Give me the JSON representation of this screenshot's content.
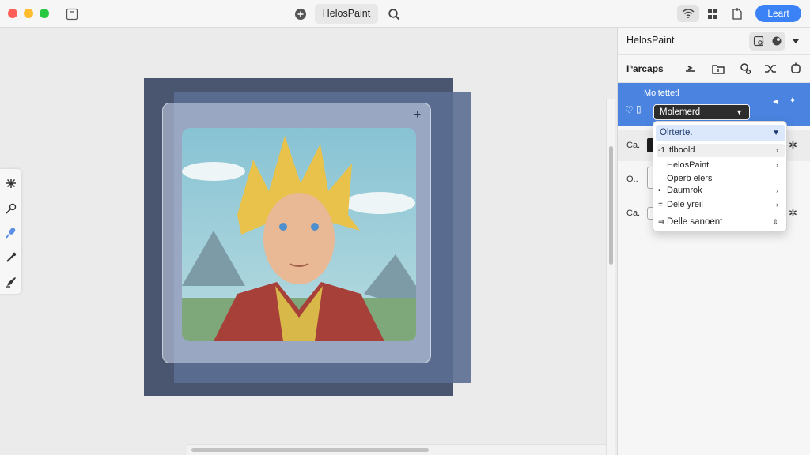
{
  "window": {
    "title": "HelosPaint",
    "primary_button": "Lea‍rt"
  },
  "panel": {
    "title": "HelosPaint",
    "tools_label": "Iᐢarcaps",
    "selected_label": "Moltettetl",
    "dropdown_value": "Molemerd",
    "row1_label": "Ca.",
    "row2_label": "O..",
    "row3_label": "Ca."
  },
  "menu": {
    "header": "Olrterte.",
    "items": [
      {
        "prefix": "-1",
        "label": "Itlboold",
        "arrow": "›"
      },
      {
        "prefix": "",
        "label": "HelosPaint",
        "arrow": "›"
      },
      {
        "prefix": "",
        "label": "Operb elers",
        "arrow": ""
      },
      {
        "prefix": "•",
        "label": "Daumrok",
        "arrow": "›"
      },
      {
        "prefix": "=",
        "label": "Dele yreil",
        "arrow": "›"
      },
      {
        "prefix": "⇒",
        "label": "Delle sanoent",
        "arrow": "⇕"
      }
    ]
  },
  "icons": {
    "tools": [
      "magic-wand-icon",
      "pencil-icon",
      "brush-icon",
      "eyedropper-icon",
      "pen-icon"
    ]
  },
  "colors": {
    "accent": "#3b82f6",
    "selection": "#4a84e0"
  }
}
